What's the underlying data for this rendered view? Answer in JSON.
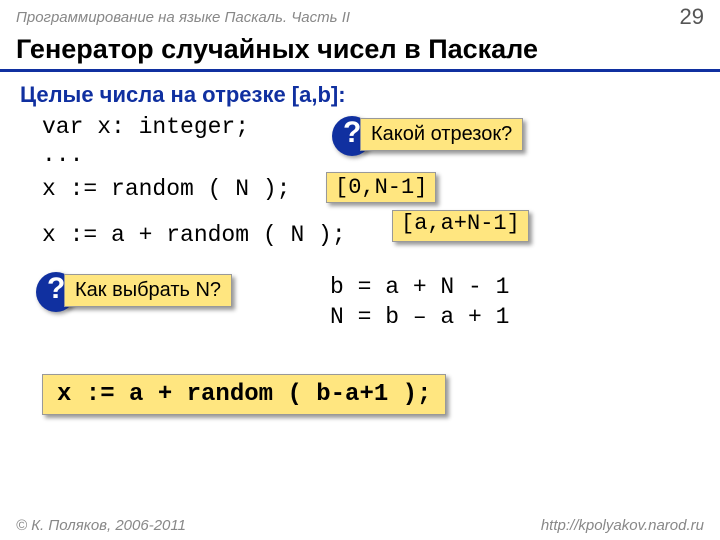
{
  "header": {
    "course": "Программирование на языке Паскаль. Часть II",
    "page": "29"
  },
  "title": "Генератор случайных чисел в Паскале",
  "subtitle": "Целые числа на отрезке [a,b]:",
  "code": {
    "l1": "var x: integer;",
    "l2": "...",
    "l3": "x := random ( N );",
    "l4": "x := a + random ( N );"
  },
  "callouts": {
    "q1": "Какой отрезок?",
    "range1": "[0,N-1]",
    "range2": "[a,a+N-1]",
    "q2": "Как выбрать N?"
  },
  "math": {
    "m1": "b = a + N - 1",
    "m2": "N = b – a + 1"
  },
  "final": "x := a + random ( b-a+1 );",
  "footer": {
    "copyright": "© К. Поляков, 2006-2011",
    "url": "http://kpolyakov.narod.ru"
  }
}
